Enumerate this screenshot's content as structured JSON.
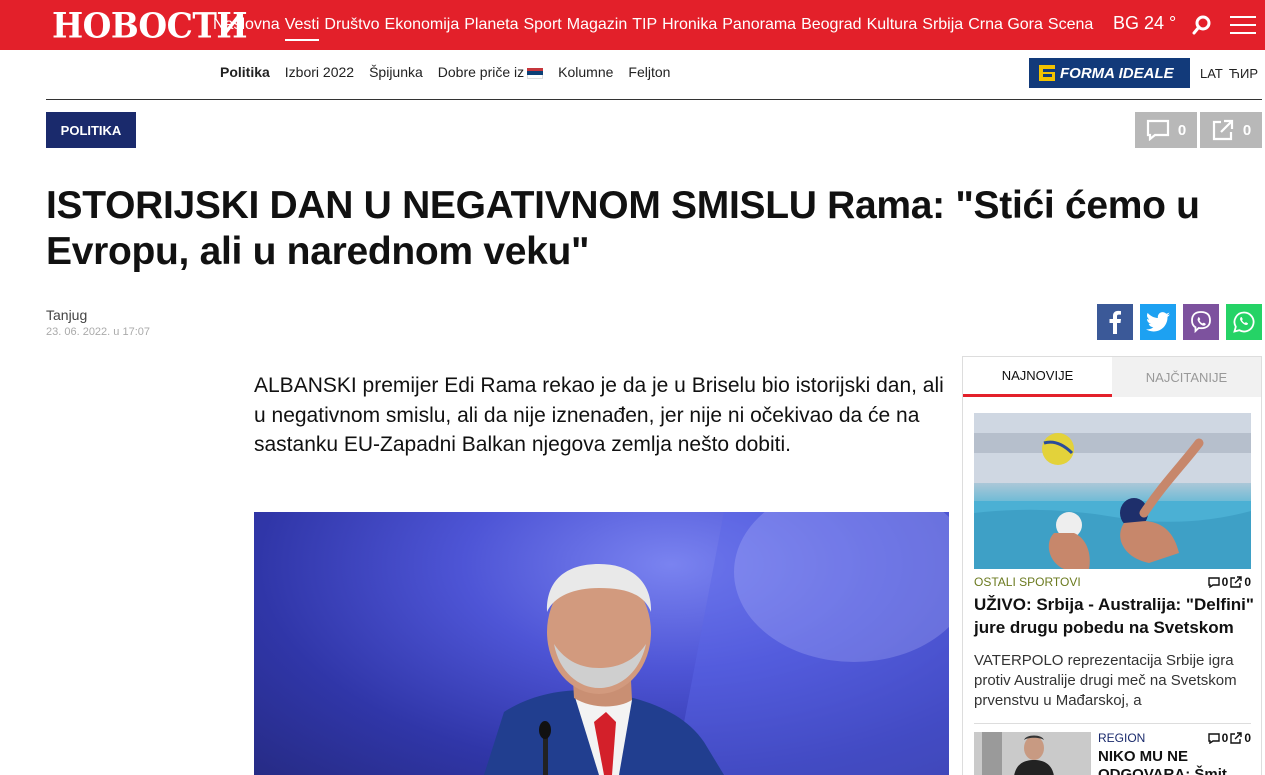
{
  "header": {
    "logo": "НОВОСТИ",
    "nav": [
      "Naslovna",
      "Vesti",
      "Društvo",
      "Ekonomija",
      "Planeta",
      "Sport",
      "Magazin",
      "TIP",
      "Hronika",
      "Panorama",
      "Beograd",
      "Kultura",
      "Srbija",
      "Crna Gora",
      "Scena"
    ],
    "active_nav": "Vesti",
    "weather": "BG 24 °"
  },
  "subnav": {
    "items": [
      "Politika",
      "Izbori 2022",
      "Špijunka",
      "Dobre priče iz",
      "Kolumne",
      "Feljton"
    ],
    "sponsor": "FORMA IDEALE",
    "lang_lat": "LAT",
    "lang_cyr": "ЋИР"
  },
  "article": {
    "category": "POLITIKA",
    "comments_count": "0",
    "shares_count": "0",
    "headline": "ISTORIJSKI DAN U NEGATIVNOM SMISLU Rama: \"Stići ćemo u Evropu, ali u narednom veku\"",
    "source": "Tanjug",
    "date": "23. 06. 2022. u 17:07",
    "lead": "ALBANSKI premijer Edi Rama rekao je da je u Briselu bio istorijski dan, ali u negativnom smislu, ali da nije iznenađen, jer nije ni očekivao da će na sastanku EU-Zapadni Balkan njegova zemlja nešto dobiti."
  },
  "sidebar": {
    "tabs": [
      "NAJNOVIJE",
      "NAJČITANIJE"
    ],
    "items": [
      {
        "category": "OSTALI SPORTOVI",
        "comments": "0",
        "shares": "0",
        "title": "UŽIVO: Srbija - Australija: \"Delfini\" jure drugu pobedu na Svetskom",
        "summary": "VATERPOLO reprezentacija Srbije igra protiv Australije drugi meč na Svetskom prvenstvu u Mađarskoj, a"
      },
      {
        "category": "REGION",
        "comments": "0",
        "shares": "0",
        "title": "NIKO MU NE ODGOVARA: Šmit"
      }
    ]
  },
  "colors": {
    "brand_red": "#e3202a",
    "category_navy": "#1a2a6c",
    "facebook": "#3b5998",
    "twitter": "#1da1f2",
    "viber": "#7d529e",
    "whatsapp": "#25d366"
  }
}
